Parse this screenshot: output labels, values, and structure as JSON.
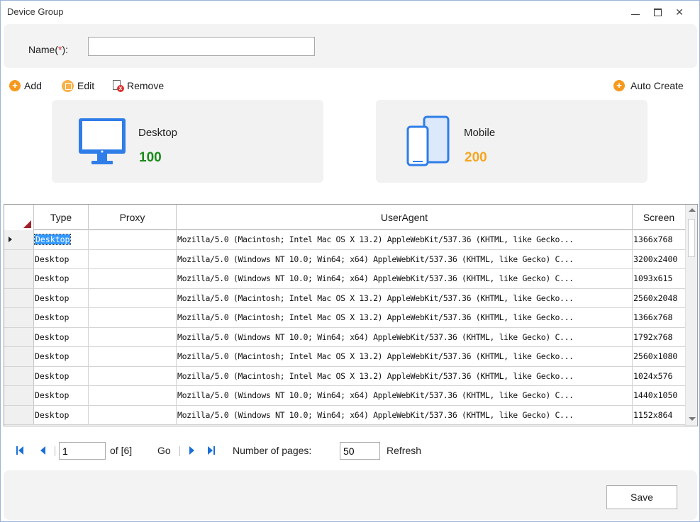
{
  "window": {
    "title": "Device Group",
    "min_glyph": "",
    "close_glyph": "✕"
  },
  "form": {
    "name_label": "Name(",
    "required_mark": "*",
    "name_label_end": "):",
    "name_value": ""
  },
  "toolbar": {
    "add_label": "Add",
    "edit_label": "Edit",
    "remove_label": "Remove",
    "auto_create_label": "Auto Create",
    "plus_glyph": "+"
  },
  "summary": {
    "desktop": {
      "label": "Desktop",
      "count": "100"
    },
    "mobile": {
      "label": "Mobile",
      "count": "200"
    }
  },
  "grid": {
    "columns": [
      "Type",
      "Proxy",
      "UserAgent",
      "Screen"
    ],
    "rows": [
      {
        "type": "Desktop",
        "proxy": "",
        "ua": "Mozilla/5.0 (Macintosh; Intel Mac OS X 13.2) AppleWebKit/537.36 (KHTML, like Gecko...",
        "screen": "1366x768"
      },
      {
        "type": "Desktop",
        "proxy": "",
        "ua": "Mozilla/5.0 (Windows NT 10.0; Win64; x64) AppleWebKit/537.36 (KHTML, like Gecko) C...",
        "screen": "3200x2400"
      },
      {
        "type": "Desktop",
        "proxy": "",
        "ua": "Mozilla/5.0 (Windows NT 10.0; Win64; x64) AppleWebKit/537.36 (KHTML, like Gecko) C...",
        "screen": "1093x615"
      },
      {
        "type": "Desktop",
        "proxy": "",
        "ua": "Mozilla/5.0 (Macintosh; Intel Mac OS X 13.2) AppleWebKit/537.36 (KHTML, like Gecko...",
        "screen": "2560x2048"
      },
      {
        "type": "Desktop",
        "proxy": "",
        "ua": "Mozilla/5.0 (Macintosh; Intel Mac OS X 13.2) AppleWebKit/537.36 (KHTML, like Gecko...",
        "screen": "1366x768"
      },
      {
        "type": "Desktop",
        "proxy": "",
        "ua": "Mozilla/5.0 (Windows NT 10.0; Win64; x64) AppleWebKit/537.36 (KHTML, like Gecko) C...",
        "screen": "1792x768"
      },
      {
        "type": "Desktop",
        "proxy": "",
        "ua": "Mozilla/5.0 (Macintosh; Intel Mac OS X 13.2) AppleWebKit/537.36 (KHTML, like Gecko...",
        "screen": "2560x1080"
      },
      {
        "type": "Desktop",
        "proxy": "",
        "ua": "Mozilla/5.0 (Macintosh; Intel Mac OS X 13.2) AppleWebKit/537.36 (KHTML, like Gecko...",
        "screen": "1024x576"
      },
      {
        "type": "Desktop",
        "proxy": "",
        "ua": "Mozilla/5.0 (Windows NT 10.0; Win64; x64) AppleWebKit/537.36 (KHTML, like Gecko) C...",
        "screen": "1440x1050"
      },
      {
        "type": "Desktop",
        "proxy": "",
        "ua": "Mozilla/5.0 (Windows NT 10.0; Win64; x64) AppleWebKit/537.36 (KHTML, like Gecko) C...",
        "screen": "1152x864"
      }
    ]
  },
  "pager": {
    "current_page": "1",
    "of_label": "of [6]",
    "go_label": "Go",
    "page_size_label": "Number of pages:",
    "page_size": "50",
    "refresh_label": "Refresh"
  },
  "footer": {
    "save_label": "Save"
  },
  "colors": {
    "accent": "#1a6fd6",
    "desktop_count": "#1a8a1a",
    "mobile_count": "#f5a623",
    "toolbar_icon": "#f59a1f"
  }
}
